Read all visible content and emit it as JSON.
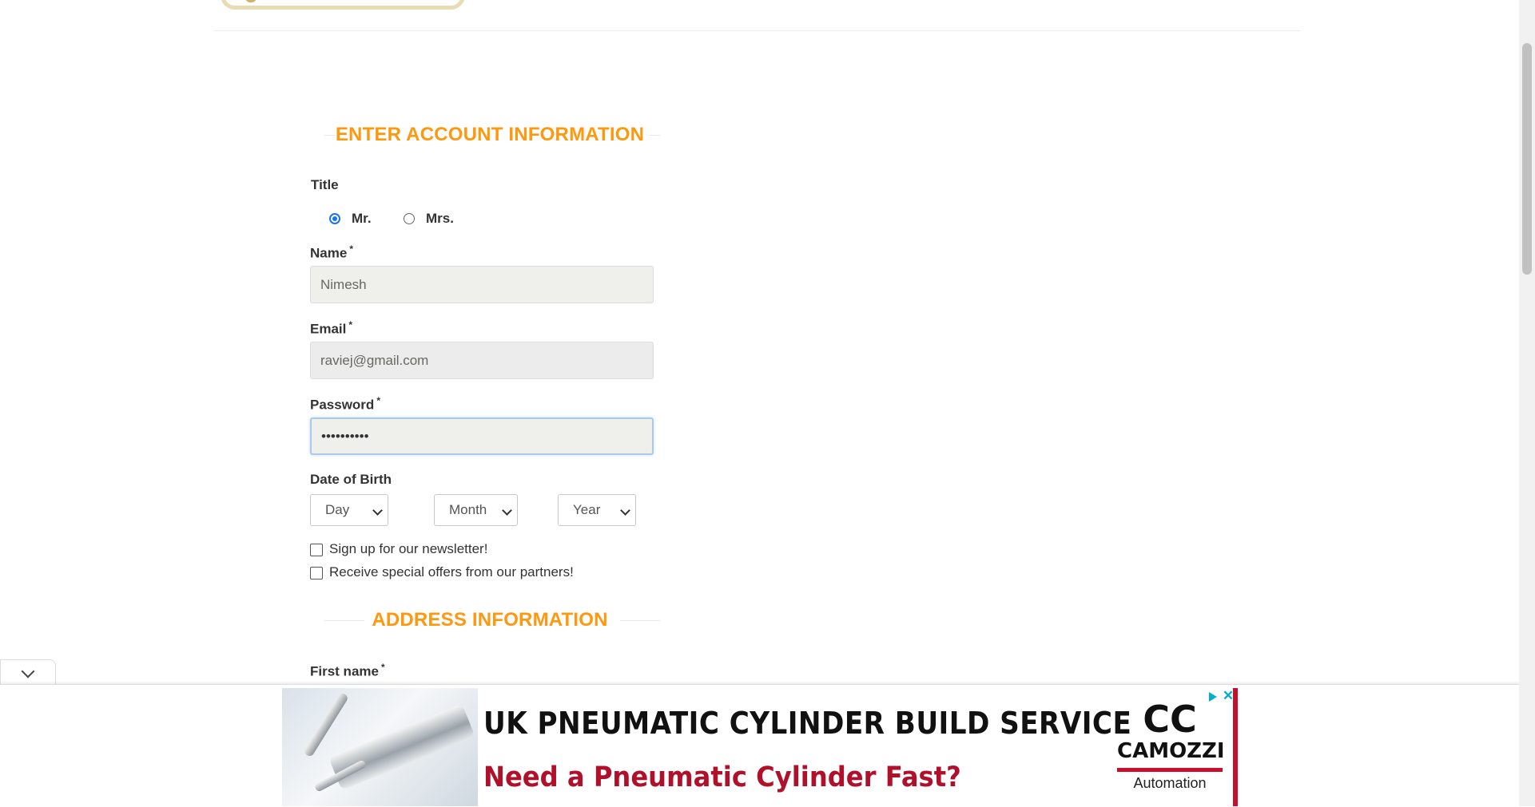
{
  "account_section": {
    "title": "ENTER ACCOUNT INFORMATION",
    "title_label": "Title",
    "title_options": [
      {
        "label": "Mr.",
        "checked": true
      },
      {
        "label": "Mrs.",
        "checked": false
      }
    ],
    "name": {
      "label": "Name",
      "required": "*",
      "value": "Nimesh"
    },
    "email": {
      "label": "Email",
      "required": "*",
      "value": "raviej@gmail.com"
    },
    "password": {
      "label": "Password",
      "required": "*",
      "value": "••••••••••"
    },
    "dob": {
      "label": "Date of Birth",
      "day": "Day",
      "month": "Month",
      "year": "Year"
    },
    "newsletter": {
      "label": "Sign up for our newsletter!",
      "checked": false
    },
    "offers": {
      "label": "Receive special offers from our partners!",
      "checked": false
    }
  },
  "address_section": {
    "title": "ADDRESS INFORMATION",
    "first_name": {
      "label": "First name",
      "required": "*"
    }
  },
  "ad": {
    "headline": "UK PNEUMATIC CYLINDER BUILD SERVICE",
    "subline": "Need a Pneumatic Cylinder Fast?",
    "brand_mark": "CC",
    "brand_name": "CAMOZZI",
    "brand_tagline": "Automation",
    "close_glyph": "✕"
  },
  "colors": {
    "accent": "#fe980f",
    "input_bg": "#efefeb",
    "radio_selected": "#1a73e8",
    "ad_red": "#b0102a"
  }
}
